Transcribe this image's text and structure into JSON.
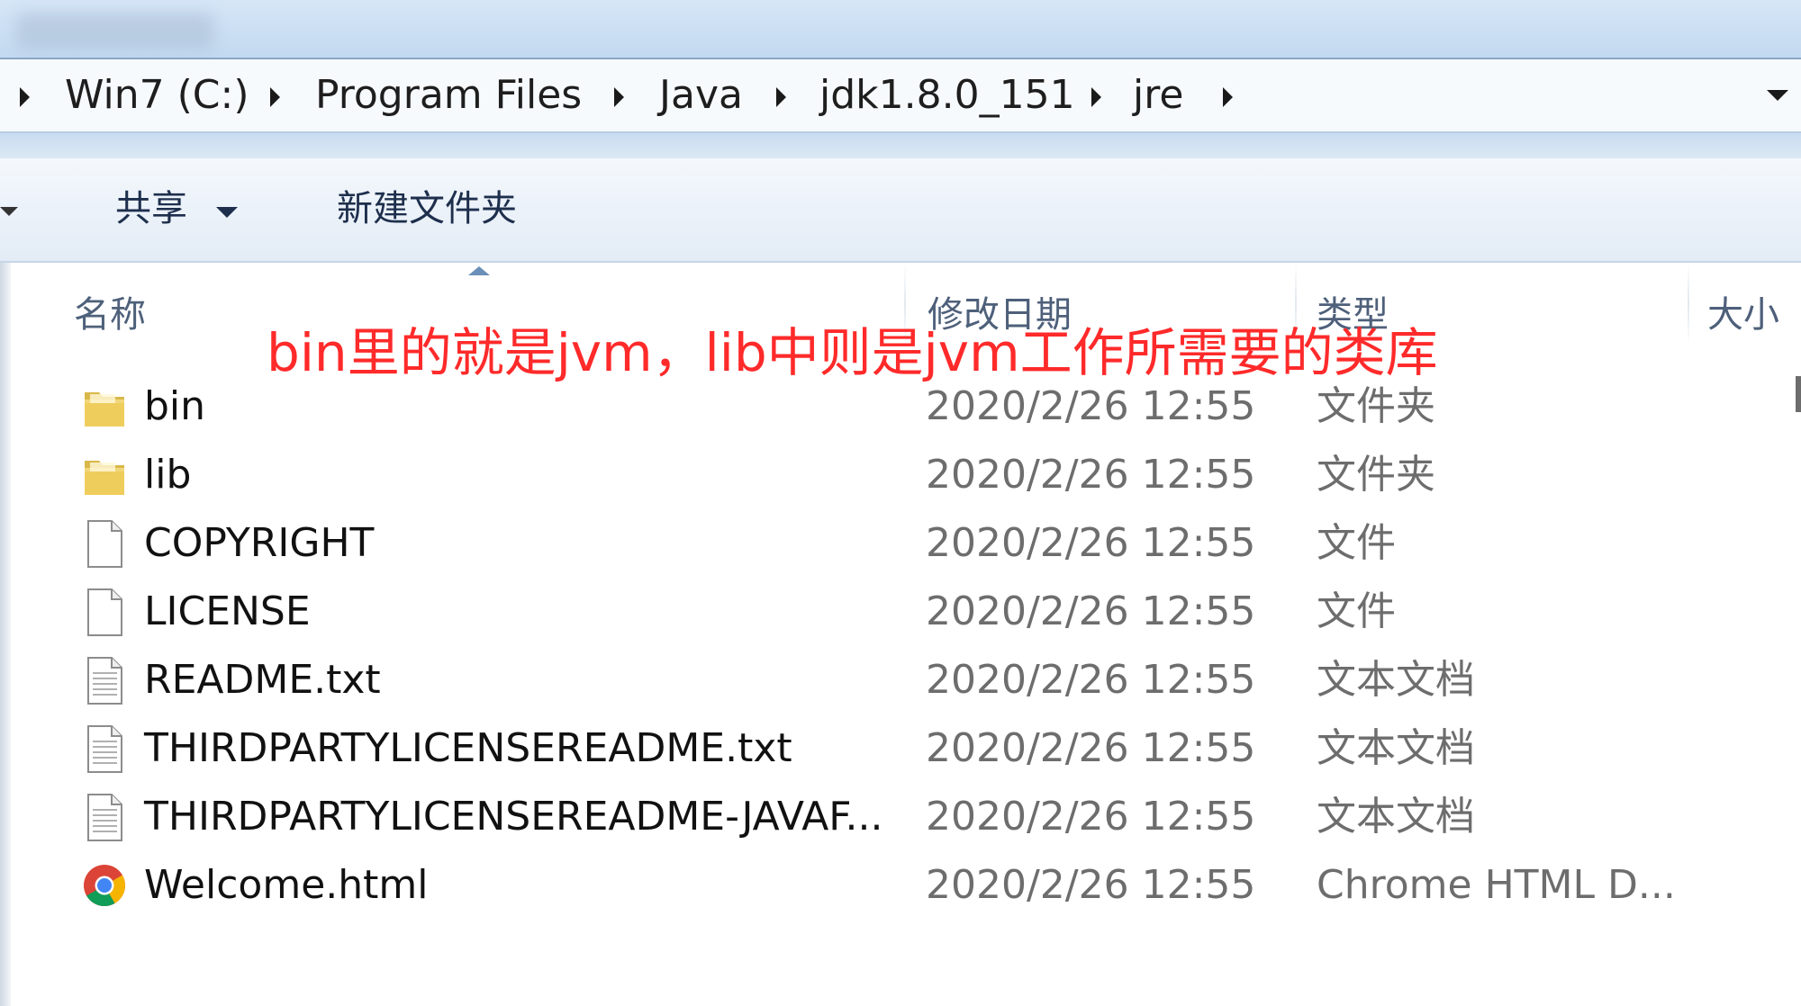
{
  "address_bar": {
    "crumbs": [
      "Win7 (C:)",
      "Program Files",
      "Java",
      "jdk1.8.0_151",
      "jre"
    ]
  },
  "toolbar": {
    "share_label": "共享",
    "new_folder_label": "新建文件夹"
  },
  "columns": {
    "name": "名称",
    "modified": "修改日期",
    "type": "类型",
    "size": "大小"
  },
  "annotation": "bin里的就是jvm，lib中则是jvm工作所需要的类库",
  "files": [
    {
      "name": "bin",
      "modified": "2020/2/26 12:55",
      "type": "文件夹",
      "icon": "folder-icon"
    },
    {
      "name": "lib",
      "modified": "2020/2/26 12:55",
      "type": "文件夹",
      "icon": "folder-icon"
    },
    {
      "name": "COPYRIGHT",
      "modified": "2020/2/26 12:55",
      "type": "文件",
      "icon": "file-icon"
    },
    {
      "name": "LICENSE",
      "modified": "2020/2/26 12:55",
      "type": "文件",
      "icon": "file-icon"
    },
    {
      "name": "README.txt",
      "modified": "2020/2/26 12:55",
      "type": "文本文档",
      "icon": "text-file-icon"
    },
    {
      "name": "THIRDPARTYLICENSEREADME.txt",
      "modified": "2020/2/26 12:55",
      "type": "文本文档",
      "icon": "text-file-icon"
    },
    {
      "name": "THIRDPARTYLICENSEREADME-JAVAF...",
      "modified": "2020/2/26 12:55",
      "type": "文本文档",
      "icon": "text-file-icon"
    },
    {
      "name": "Welcome.html",
      "modified": "2020/2/26 12:55",
      "type": "Chrome HTML D...",
      "icon": "chrome-icon"
    }
  ],
  "colors": {
    "annotation": "#ff2a2a",
    "toolbar_text": "#1e2f4d",
    "header_text": "#4e607a",
    "secondary_text": "#6d6d6d"
  }
}
